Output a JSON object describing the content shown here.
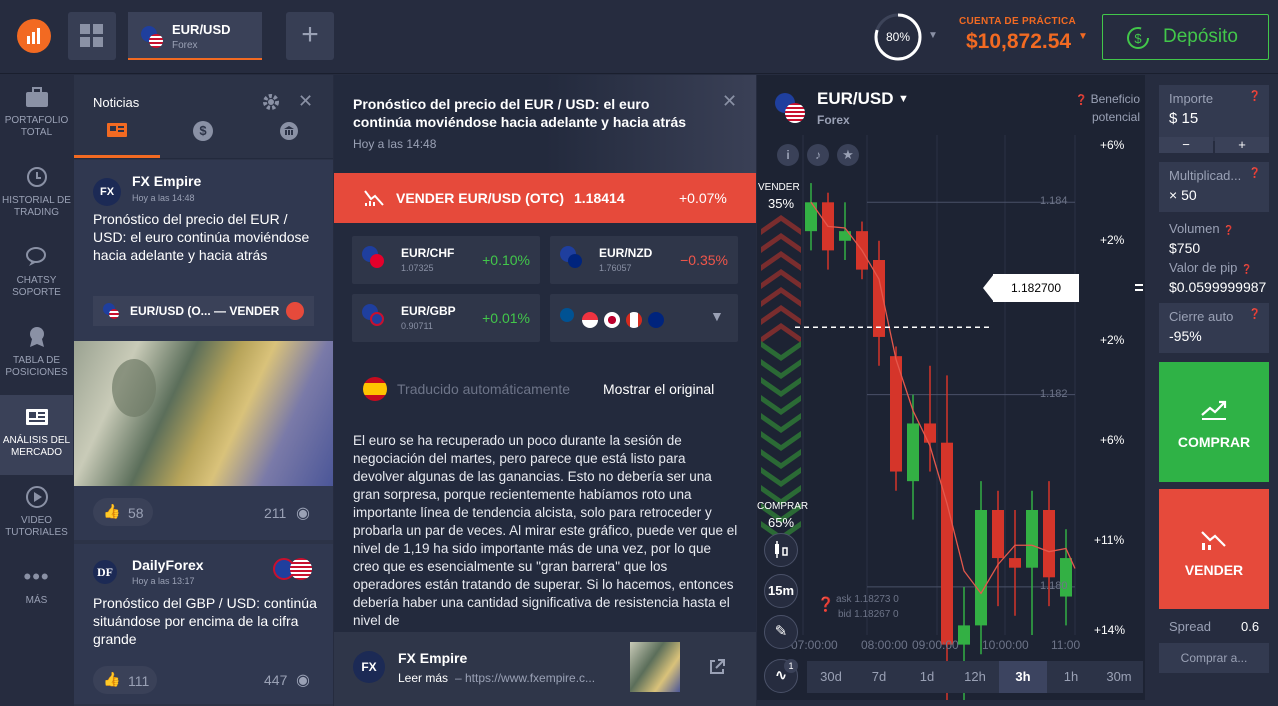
{
  "topbar": {
    "tab": {
      "symbol": "EUR/USD",
      "category": "Forex"
    },
    "progress": {
      "label": "80%",
      "value": 0.8
    },
    "account": {
      "type": "CUENTA DE PRÁCTICA",
      "balance": "$10,872.54"
    },
    "deposit_label": "Depósito"
  },
  "leftnav": [
    {
      "label": "PORTAFOLIO TOTAL",
      "icon": "briefcase-icon"
    },
    {
      "label": "HISTORIAL DE TRADING",
      "icon": "history-icon"
    },
    {
      "label": "CHATSY SOPORTE",
      "icon": "chat-icon"
    },
    {
      "label": "TABLA DE POSICIONES",
      "icon": "medal-icon"
    },
    {
      "label": "ANÁLISIS DEL MERCADO",
      "icon": "newspaper-icon",
      "active": true
    },
    {
      "label": "VIDEO TUTORIALES",
      "icon": "play-icon"
    },
    {
      "label": "MÁS",
      "icon": "more-icon"
    }
  ],
  "news": {
    "title": "Noticias",
    "items": [
      {
        "source": "FX Empire",
        "time": "Hoy a las 14:48",
        "headline": "Pronóstico del precio del EUR / USD: el euro continúa moviéndose hacia adelante y hacia atrás",
        "tag": "EUR/USD (O... — VENDER",
        "likes": "58",
        "views": "211"
      },
      {
        "source": "DailyForex",
        "time": "Hoy a las 13:17",
        "headline": "Pronóstico del GBP / USD: continúa situándose por encima de la cifra grande",
        "likes": "111",
        "views": "447"
      }
    ]
  },
  "article": {
    "title": "Pronóstico del precio del EUR / USD: el euro continúa moviéndose hacia adelante y hacia atrás",
    "time": "Hoy a las 14:48",
    "sell_bar": {
      "label": "VENDER EUR/USD (OTC)",
      "price": "1.18414",
      "change": "+0.07%"
    },
    "assets": [
      {
        "symbol": "EUR/CHF",
        "price": "1.07325",
        "change": "+0.10%",
        "positive": true
      },
      {
        "symbol": "EUR/NZD",
        "price": "1.76057",
        "change": "−0.35%",
        "positive": false
      },
      {
        "symbol": "EUR/GBP",
        "price": "0.90711",
        "change": "+0.01%",
        "positive": true
      }
    ],
    "translated_label": "Traducido automáticamente",
    "show_original": "Mostrar el original",
    "body": "El euro se ha recuperado un poco durante la sesión de negociación del martes, pero parece que está listo para devolver algunas de las ganancias. Esto no debería ser una gran sorpresa, porque recientemente habíamos roto una importante línea de tendencia alcista, solo para retroceder y probarla un par de veces. Al mirar este gráfico, puede ver que el nivel de 1,19 ha sido importante más de una vez, por lo que creo que es esencialmente su \"gran barrera\" que los operadores están tratando de superar. Si lo hacemos, entonces debería haber una cantidad significativa de resistencia hasta el nivel de",
    "footer": {
      "source": "FX Empire",
      "read_more": "Leer más",
      "url": "– https://www.fxempire.c..."
    }
  },
  "chart": {
    "symbol": "EUR/USD",
    "category": "Forex",
    "sell": {
      "label": "VENDER",
      "pct": "35%"
    },
    "buy": {
      "label": "COMPRAR",
      "pct": "65%"
    },
    "price_tag": "1.182700",
    "ask": "ask 1.18273 0",
    "bid": "bid 1.18267 0",
    "profit_label": "Beneficio potencial",
    "profit_levels": [
      "+6%",
      "+2%",
      "+2%",
      "+6%",
      "+11%",
      "+14%"
    ],
    "y_ticks": [
      "1.184",
      "1.182",
      "1.180"
    ],
    "x_ticks": [
      "07:00:00",
      "08:00:00",
      "09:00:00",
      "10:00:00",
      "11:00"
    ],
    "timeframes": [
      "30d",
      "7d",
      "1d",
      "12h",
      "3h",
      "1h",
      "30m"
    ],
    "active_timeframe": "3h",
    "tool_time": "15m",
    "indicator_badge": "1"
  },
  "chart_data": {
    "type": "candlestick",
    "y_ticks": [
      1.184,
      1.182,
      1.18
    ],
    "ylim": [
      1.1795,
      1.1847
    ],
    "x_ticks": [
      "07:00:00",
      "08:00:00",
      "09:00:00",
      "10:00:00",
      "11:00"
    ],
    "candles": [
      {
        "open": 1.1837,
        "close": 1.184,
        "high": 1.1842,
        "low": 1.1835
      },
      {
        "open": 1.184,
        "close": 1.1835,
        "high": 1.1841,
        "low": 1.1833
      },
      {
        "open": 1.1836,
        "close": 1.1837,
        "high": 1.184,
        "low": 1.1834
      },
      {
        "open": 1.1837,
        "close": 1.1833,
        "high": 1.1838,
        "low": 1.1832
      },
      {
        "open": 1.1834,
        "close": 1.1826,
        "high": 1.1836,
        "low": 1.1823
      },
      {
        "open": 1.1824,
        "close": 1.1812,
        "high": 1.1825,
        "low": 1.181
      },
      {
        "open": 1.1811,
        "close": 1.1817,
        "high": 1.182,
        "low": 1.1807
      },
      {
        "open": 1.1817,
        "close": 1.1815,
        "high": 1.1823,
        "low": 1.1812
      },
      {
        "open": 1.1815,
        "close": 1.1794,
        "high": 1.1822,
        "low": 1.1787
      },
      {
        "open": 1.1794,
        "close": 1.1796,
        "high": 1.18,
        "low": 1.1784
      },
      {
        "open": 1.1796,
        "close": 1.1808,
        "high": 1.1811,
        "low": 1.1793
      },
      {
        "open": 1.1808,
        "close": 1.1803,
        "high": 1.181,
        "low": 1.1798
      },
      {
        "open": 1.1803,
        "close": 1.1802,
        "high": 1.1808,
        "low": 1.1797
      },
      {
        "open": 1.1802,
        "close": 1.1808,
        "high": 1.181,
        "low": 1.1795
      },
      {
        "open": 1.1808,
        "close": 1.1801,
        "high": 1.1811,
        "low": 1.1798
      },
      {
        "open": 1.1799,
        "close": 1.1803,
        "high": 1.1806,
        "low": 1.1796
      }
    ],
    "current_price": 1.1827,
    "buy_pct": 65,
    "sell_pct": 35
  },
  "rightpanel": {
    "amount": {
      "label": "Importe",
      "value": "$ 15"
    },
    "multiplier": {
      "label": "Multiplicad...",
      "value": "× 50"
    },
    "volume": {
      "label": "Volumen",
      "value": "$750"
    },
    "pip": {
      "label": "Valor de pip",
      "value": "$0.0599999987"
    },
    "autoclose": {
      "label": "Cierre auto",
      "value": "-95%"
    },
    "buy_label": "COMPRAR",
    "sell_label": "VENDER",
    "spread_label": "Spread",
    "spread_value": "0.6",
    "buy_at": "Comprar a..."
  },
  "colors": {
    "accent": "#f26a22",
    "green": "#42c74a",
    "red": "#e64a3b",
    "bg": "#262c3f"
  }
}
